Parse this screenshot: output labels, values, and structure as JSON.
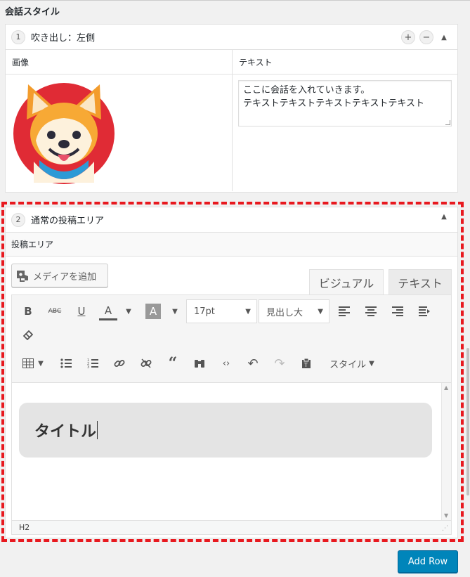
{
  "section": {
    "title": "会話スタイル"
  },
  "row1": {
    "number": "1",
    "title": "吹き出し：左側",
    "add": "+",
    "remove": "−",
    "collapse": "▲",
    "col_image": "画像",
    "col_text": "テキスト",
    "textarea_value": "ここに会話を入れていきます。\nテキストテキストテキストテキストテキスト"
  },
  "row2": {
    "number": "2",
    "title": "通常の投稿エリア",
    "collapse": "▲",
    "label": "投稿エリア"
  },
  "editor": {
    "media_button": "メディアを追加",
    "tab_visual": "ビジュアル",
    "tab_text": "テキスト",
    "font_size": "17pt",
    "heading": "見出し大",
    "styles": "スタイル",
    "content_title": "タイトル",
    "status_path": "H2"
  },
  "footer": {
    "add_row": "Add Row"
  },
  "colors": {
    "accent": "#0085ba",
    "dashed_border": "#e8191f"
  }
}
